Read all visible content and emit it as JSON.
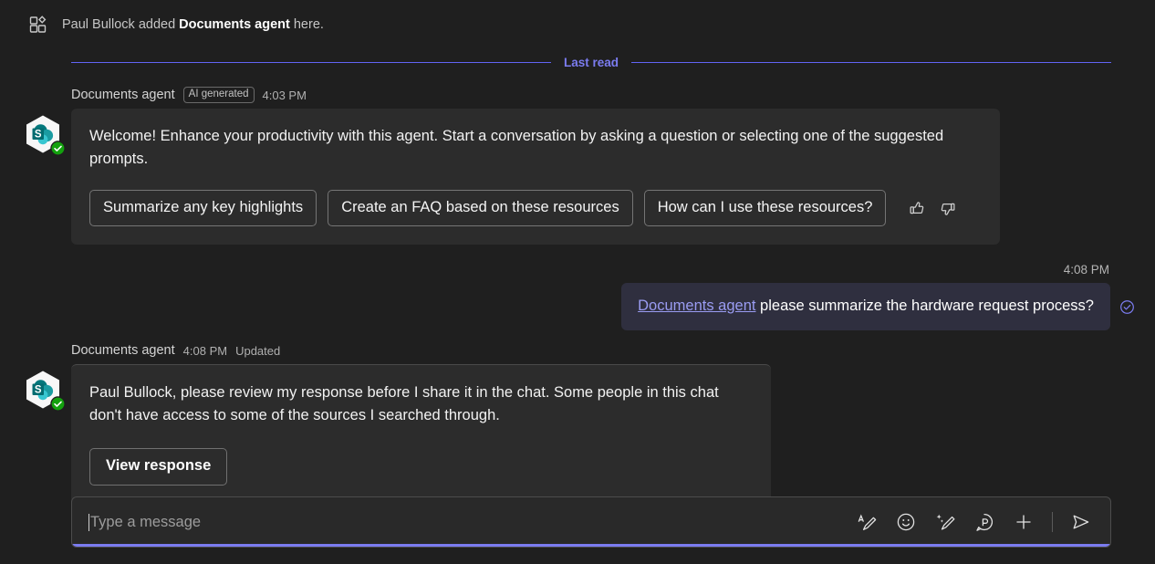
{
  "system_message": {
    "icon": "add-app-grid-icon",
    "prefix": "Paul Bullock added ",
    "bold": "Documents agent",
    "suffix": " here."
  },
  "divider": {
    "label": "Last read",
    "color": "#6264f5"
  },
  "messages": [
    {
      "sender": "Documents agent",
      "badge": "AI generated",
      "time": "4:03 PM",
      "avatar": "sharepoint-agent-avatar",
      "body": "Welcome! Enhance your productivity with this agent. Start a conversation by asking a question or selecting one of the suggested prompts.",
      "prompts": [
        "Summarize any key highlights",
        "Create an FAQ based on these resources",
        "How can I use these resources?"
      ],
      "feedback": [
        "thumbs-up-icon",
        "thumbs-down-icon"
      ]
    },
    {
      "sender": "Documents agent",
      "time": "4:08 PM",
      "status": "Updated",
      "avatar": "sharepoint-agent-avatar",
      "body": "Paul Bullock, please review my response before I share it in the chat. Some people in this chat don't have access to some of the sources I searched through.",
      "action_label": "View response"
    }
  ],
  "outgoing": {
    "time": "4:08 PM",
    "mention": "Documents agent",
    "text": " please summarize the hardware request process?",
    "read_receipt": "message-read-icon",
    "bubble_color": "#2f2f3f"
  },
  "composer": {
    "placeholder": "Type a message",
    "actions": [
      {
        "name": "format-text-icon"
      },
      {
        "name": "emoji-icon"
      },
      {
        "name": "copilot-rewrite-icon"
      },
      {
        "name": "loop-component-icon"
      },
      {
        "name": "add-attachment-icon"
      },
      {
        "name": "send-icon"
      }
    ],
    "focus_color": "#7b7cf0"
  }
}
